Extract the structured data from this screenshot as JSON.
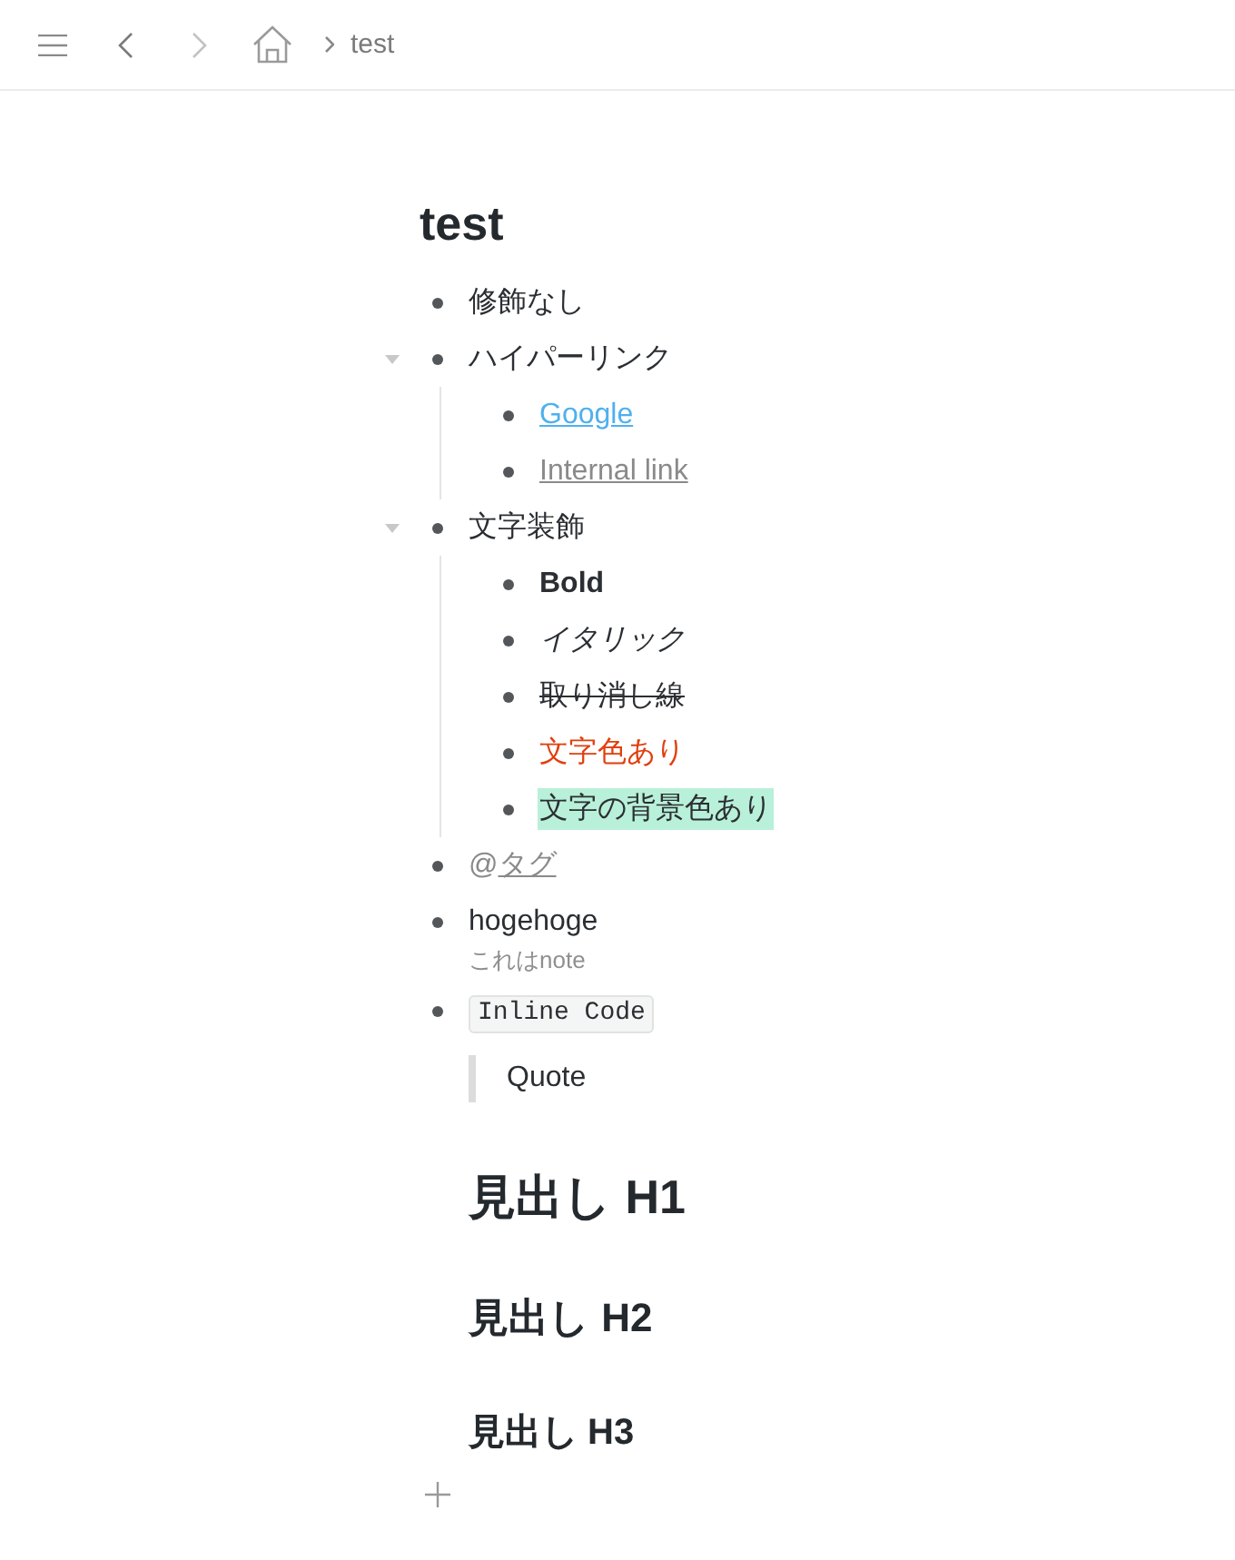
{
  "toolbar": {
    "back": {
      "disabled": false
    },
    "forward": {
      "disabled": true
    },
    "breadcrumb": "test"
  },
  "page": {
    "title": "test"
  },
  "outline": [
    {
      "kind": "text",
      "text": "修飾なし"
    },
    {
      "kind": "text",
      "text": "ハイパーリンク",
      "expanded": true,
      "children": [
        {
          "kind": "link",
          "text": "Google"
        },
        {
          "kind": "internal-link",
          "text": "Internal link"
        }
      ]
    },
    {
      "kind": "text",
      "text": "文字装飾",
      "expanded": true,
      "children": [
        {
          "kind": "bold",
          "text": "Bold"
        },
        {
          "kind": "italic",
          "text": "イタリック"
        },
        {
          "kind": "strike",
          "text": "取り消し線"
        },
        {
          "kind": "colored",
          "text": "文字色あり",
          "color": "#e0400f"
        },
        {
          "kind": "highlight",
          "text": "文字の背景色あり",
          "color": "#b9f0d9"
        }
      ]
    },
    {
      "kind": "tag",
      "prefix": "@",
      "text": "タグ"
    },
    {
      "kind": "text",
      "text": "hogehoge",
      "note": "これはnote"
    },
    {
      "kind": "code",
      "text": "Inline Code"
    }
  ],
  "blocks": [
    {
      "kind": "quote",
      "text": "Quote"
    },
    {
      "kind": "h1",
      "text": "見出し H1"
    },
    {
      "kind": "h2",
      "text": "見出し H2"
    },
    {
      "kind": "h3",
      "text": "見出し H3"
    }
  ]
}
